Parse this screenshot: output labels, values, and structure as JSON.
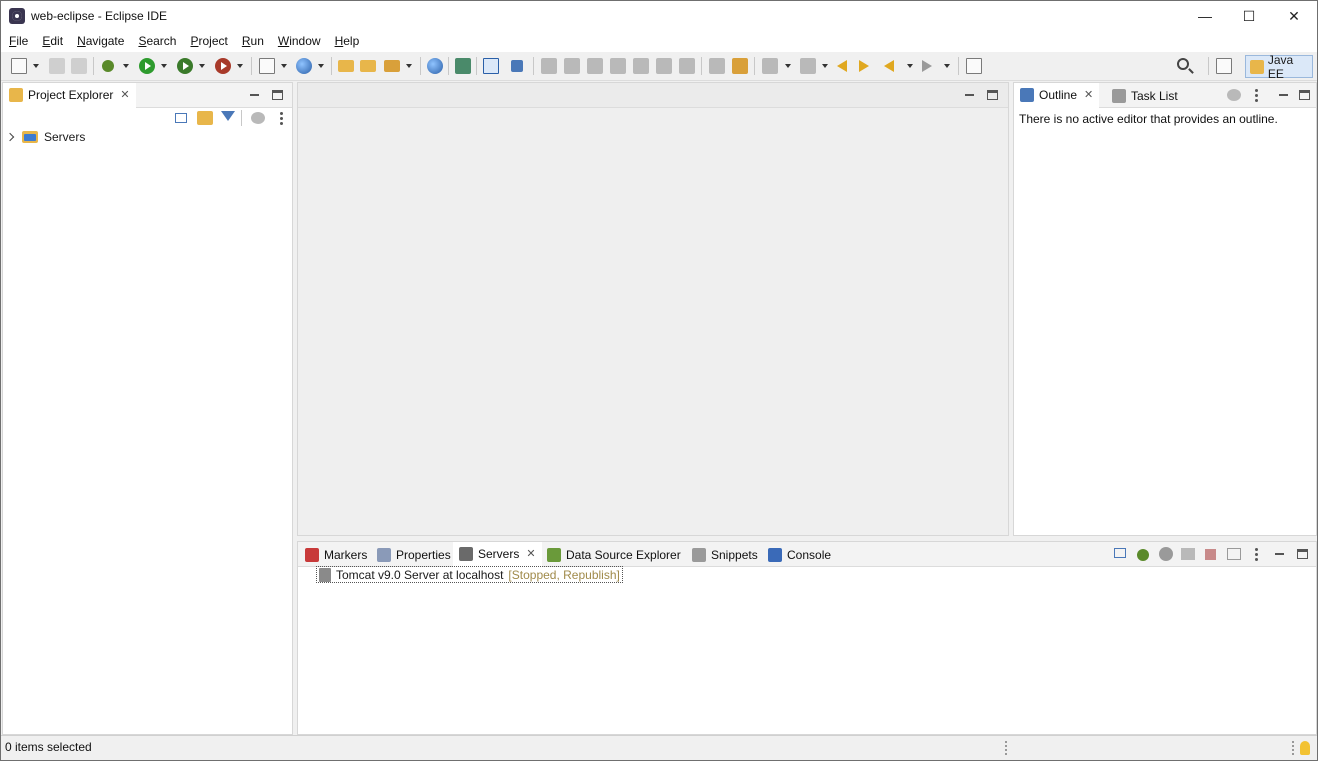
{
  "window": {
    "title": "web-eclipse - Eclipse IDE",
    "controls": {
      "minimize": "—",
      "maximize": "☐",
      "close": "✕"
    }
  },
  "menubar": [
    {
      "mnemonic": "F",
      "rest": "ile"
    },
    {
      "mnemonic": "E",
      "rest": "dit"
    },
    {
      "mnemonic": "N",
      "rest": "avigate"
    },
    {
      "mnemonic": "S",
      "rest": "earch"
    },
    {
      "mnemonic": "P",
      "rest": "roject"
    },
    {
      "mnemonic": "R",
      "rest": "un"
    },
    {
      "mnemonic": "W",
      "rest": "indow"
    },
    {
      "mnemonic": "H",
      "rest": "elp"
    }
  ],
  "toolbar": {
    "perspective": "Java EE"
  },
  "project_explorer": {
    "tab": "Project Explorer",
    "tree": [
      {
        "label": "Servers"
      }
    ]
  },
  "outline": {
    "tabs": [
      "Outline",
      "Task List"
    ],
    "message": "There is no active editor that provides an outline."
  },
  "bottom": {
    "tabs": [
      "Markers",
      "Properties",
      "Servers",
      "Data Source Explorer",
      "Snippets",
      "Console"
    ],
    "active_tab": "Servers",
    "server": {
      "name": "Tomcat v9.0 Server at localhost",
      "status": "[Stopped, Republish]"
    }
  },
  "statusbar": {
    "text": "0 items selected"
  }
}
